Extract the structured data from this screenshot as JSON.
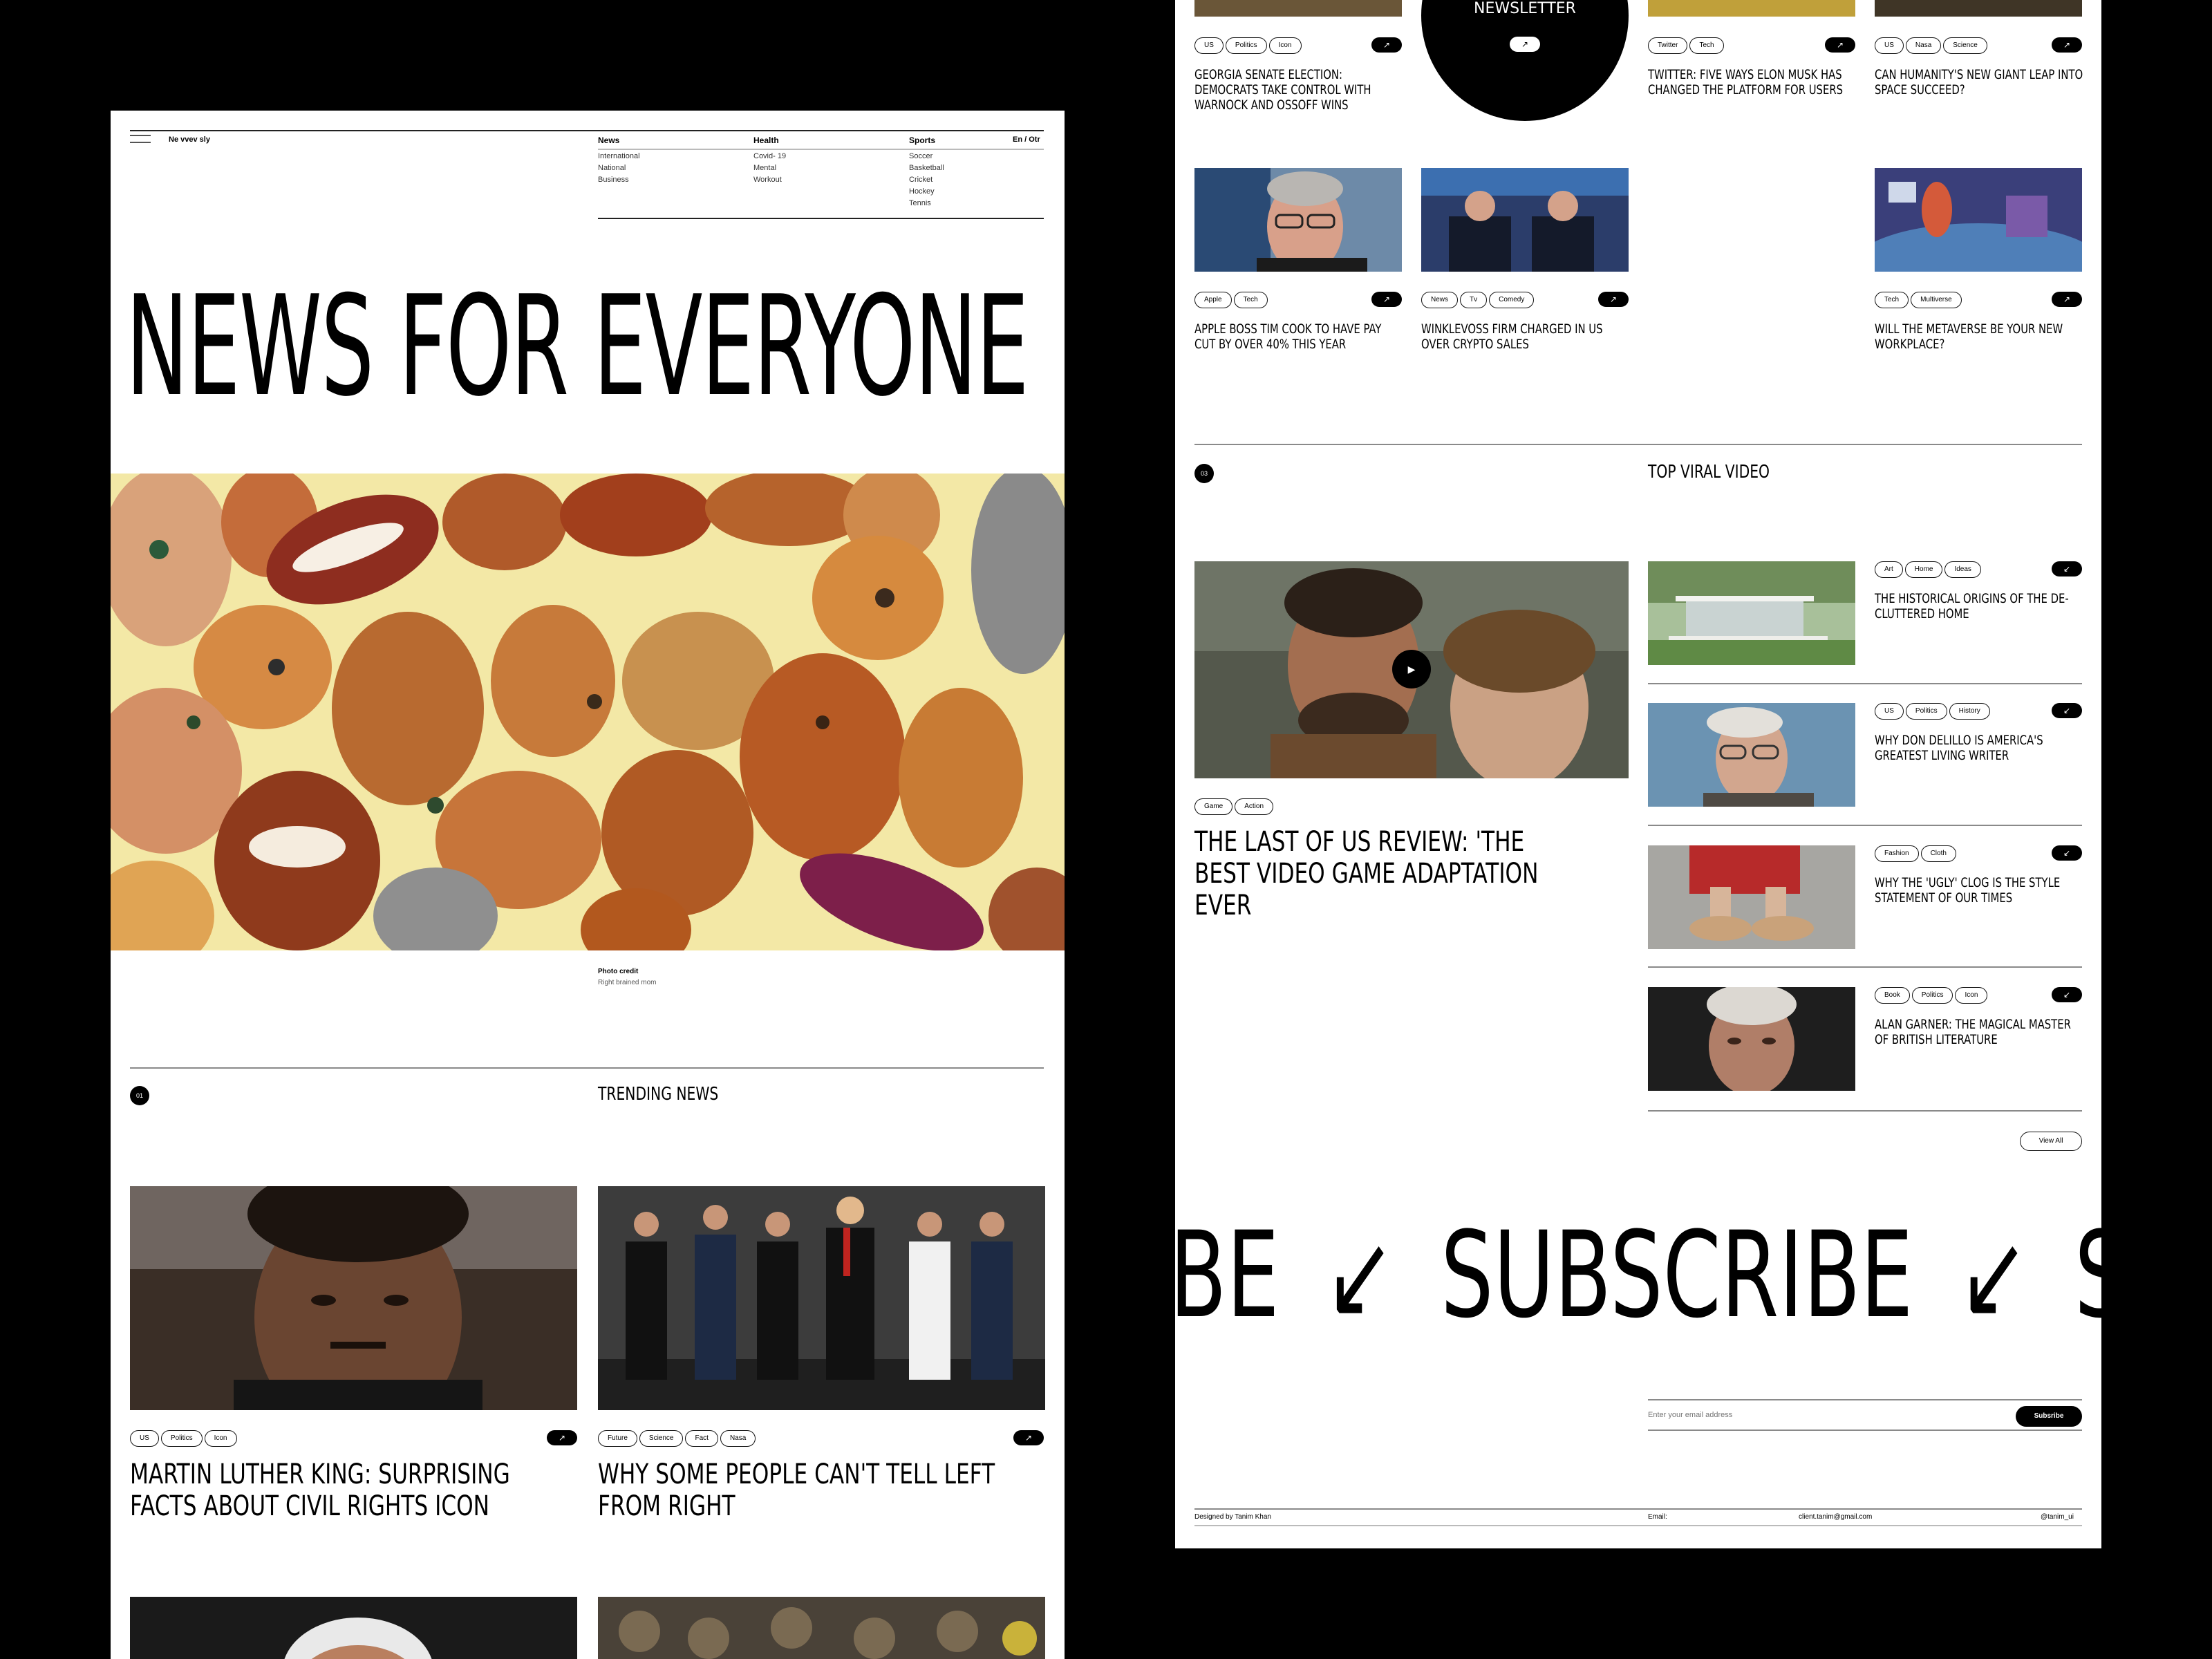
{
  "header": {
    "logo": "Ne vvev sly",
    "lang": "En / Otr",
    "nav": [
      {
        "label": "News",
        "items": [
          "International",
          "National",
          "Business"
        ]
      },
      {
        "label": "Health",
        "items": [
          "Covid- 19",
          "Mental",
          "Workout"
        ]
      },
      {
        "label": "Sports",
        "items": [
          "Soccer",
          "Basketball",
          "Cricket",
          "Hockey",
          "Tennis"
        ]
      }
    ]
  },
  "hero": {
    "title": "NEWS FOR EVERYONE",
    "credit_label": "Photo credit",
    "credit_value": "Right brained mom"
  },
  "trending": {
    "number": "01",
    "title": "TRENDING NEWS",
    "articles": [
      {
        "tags": [
          "US",
          "Politics",
          "Icon"
        ],
        "title": "MARTIN LUTHER KING: SURPRISING FACTS ABOUT CIVIL RIGHTS ICON"
      },
      {
        "tags": [
          "Future",
          "Science",
          "Fact",
          "Nasa"
        ],
        "title": "WHY SOME PEOPLE CAN'T TELL LEFT FROM RIGHT"
      }
    ]
  },
  "grid": {
    "newsletter_label": "NEWSLETTER",
    "articles": [
      {
        "tags": [
          "US",
          "Politics",
          "Icon"
        ],
        "title": "GEORGIA SENATE ELECTION: DEMOCRATS TAKE CONTROL WITH WARNOCK AND OSSOFF WINS"
      },
      {
        "tags": [
          "Twitter",
          "Tech"
        ],
        "title": "TWITTER: FIVE WAYS ELON MUSK HAS CHANGED THE PLATFORM FOR USERS"
      },
      {
        "tags": [
          "US",
          "Nasa",
          "Science"
        ],
        "title": "CAN HUMANITY'S NEW GIANT LEAP INTO SPACE SUCCEED?"
      },
      {
        "tags": [
          "Apple",
          "Tech"
        ],
        "title": "APPLE BOSS TIM COOK TO HAVE PAY CUT BY OVER 40% THIS YEAR"
      },
      {
        "tags": [
          "News",
          "Tv",
          "Comedy"
        ],
        "title": "WINKLEVOSS FIRM CHARGED IN US OVER CRYPTO SALES"
      },
      {
        "tags": [
          "Tech",
          "Multiverse"
        ],
        "title": "WILL THE METAVERSE BE YOUR NEW WORKPLACE?"
      }
    ]
  },
  "viral": {
    "number": "03",
    "title": "TOP VIRAL VIDEO",
    "main": {
      "tags": [
        "Game",
        "Action"
      ],
      "title": "THE LAST OF US REVIEW: 'THE BEST VIDEO GAME ADAPTATION EVER"
    },
    "list": [
      {
        "tags": [
          "Art",
          "Home",
          "Ideas"
        ],
        "title": "THE HISTORICAL ORIGINS OF THE DE-CLUTTERED HOME"
      },
      {
        "tags": [
          "US",
          "Politics",
          "History"
        ],
        "title": "WHY DON DELILLO IS AMERICA'S GREATEST LIVING WRITER"
      },
      {
        "tags": [
          "Fashion",
          "Cloth"
        ],
        "title": "WHY THE 'UGLY' CLOG IS THE STYLE STATEMENT OF OUR TIMES"
      },
      {
        "tags": [
          "Book",
          "Politics",
          "Icon"
        ],
        "title": "ALAN GARNER: THE MAGICAL MASTER OF BRITISH LITERATURE"
      }
    ],
    "view_all": "View All"
  },
  "subscribe": {
    "marquee": [
      "BE",
      "SUBSCRIBE",
      "SU"
    ],
    "email_placeholder": "Enter your email address",
    "button": "Subsribe"
  },
  "footer": {
    "designer": "Designed by Tanim Khan",
    "email_label": "Email:",
    "email": "client.tanim@gmail.com",
    "handle": "@tanim_ui"
  },
  "icons": {
    "arrow_out": "↗",
    "arrow_in": "↙",
    "play": "▶"
  }
}
